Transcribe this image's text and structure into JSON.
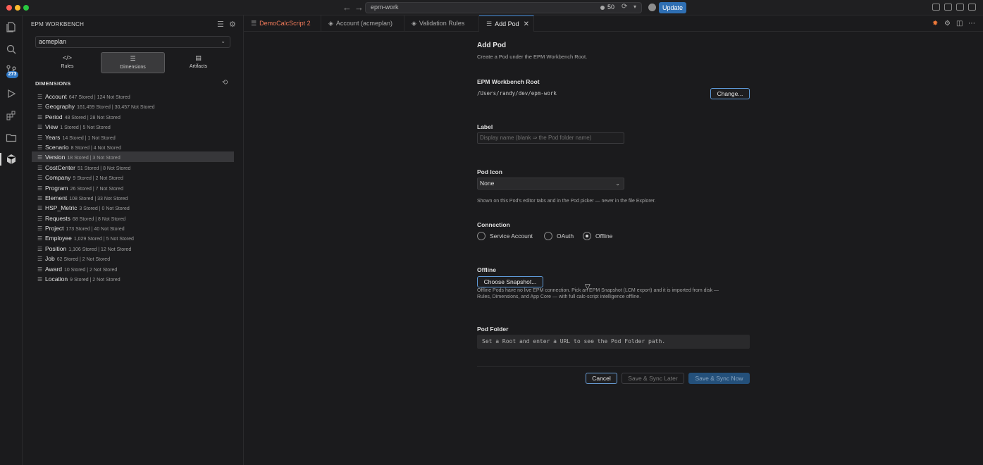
{
  "titlebar": {
    "search_text": "epm-work",
    "count": "50",
    "update_label": "Update"
  },
  "activity": {
    "badge": "273"
  },
  "sidebar": {
    "title": "EPM WORKBENCH",
    "pod_selected": "acmeplan",
    "tabs": [
      {
        "label": "Rules",
        "icon": "code-icon"
      },
      {
        "label": "Dimensions",
        "icon": "list-icon"
      },
      {
        "label": "Artifacts",
        "icon": "artifacts-icon"
      }
    ],
    "dimensions_header": "DIMENSIONS",
    "dimensions": [
      {
        "name": "Account",
        "meta": "647 Stored | 124 Not Stored"
      },
      {
        "name": "Geography",
        "meta": "161,459 Stored | 30,457 Not Stored"
      },
      {
        "name": "Period",
        "meta": "48 Stored | 28 Not Stored"
      },
      {
        "name": "View",
        "meta": "1 Stored | 5 Not Stored"
      },
      {
        "name": "Years",
        "meta": "14 Stored | 1 Not Stored"
      },
      {
        "name": "Scenario",
        "meta": "8 Stored | 4 Not Stored"
      },
      {
        "name": "Version",
        "meta": "18 Stored | 3 Not Stored"
      },
      {
        "name": "CostCenter",
        "meta": "51 Stored | 8 Not Stored"
      },
      {
        "name": "Company",
        "meta": "9 Stored | 2 Not Stored"
      },
      {
        "name": "Program",
        "meta": "26 Stored | 7 Not Stored"
      },
      {
        "name": "Element",
        "meta": "108 Stored | 33 Not Stored"
      },
      {
        "name": "HSP_Metric",
        "meta": "3 Stored | 0 Not Stored"
      },
      {
        "name": "Requests",
        "meta": "68 Stored | 8 Not Stored"
      },
      {
        "name": "Project",
        "meta": "173 Stored | 40 Not Stored"
      },
      {
        "name": "Employee",
        "meta": "1,029 Stored | 5 Not Stored"
      },
      {
        "name": "Position",
        "meta": "1,106 Stored | 12 Not Stored"
      },
      {
        "name": "Job",
        "meta": "62 Stored | 2 Not Stored"
      },
      {
        "name": "Award",
        "meta": "10 Stored | 2 Not Stored"
      },
      {
        "name": "Location",
        "meta": "9 Stored | 2 Not Stored"
      }
    ]
  },
  "tabs": [
    {
      "label": "DemoCalcScript",
      "badge": "2"
    },
    {
      "label": "Account (acmeplan)"
    },
    {
      "label": "Validation Rules"
    },
    {
      "label": "Add Pod"
    }
  ],
  "form": {
    "title": "Add Pod",
    "subtitle": "Create a Pod under the EPM Workbench Root.",
    "root_label": "EPM Workbench Root",
    "root_path": "/Users/randy/dev/epm-work",
    "change_button": "Change...",
    "label_label": "Label",
    "label_placeholder": "Display name (blank ⇒ the Pod folder name)",
    "icon_label": "Pod Icon",
    "icon_value": "None",
    "icon_help": "Shown on this Pod's editor tabs and in the Pod picker — never in the file Explorer.",
    "connection_label": "Connection",
    "connection_options": [
      "Service Account",
      "OAuth",
      "Offline"
    ],
    "connection_selected": "Offline",
    "offline_label": "Offline",
    "choose_snapshot": "Choose Snapshot...",
    "offline_help_1": "Offline Pods have no live EPM connection. Pick an EPM Snapshot (LCM export) and it is imported from disk —",
    "offline_help_2": "Rules, Dimensions, and App Core — with full calc-script intelligence offline.",
    "folder_label": "Pod Folder",
    "folder_text": "Set a Root and enter a URL to see the Pod Folder path.",
    "cancel": "Cancel",
    "save_later": "Save & Sync Later",
    "save_now": "Save & Sync Now"
  }
}
